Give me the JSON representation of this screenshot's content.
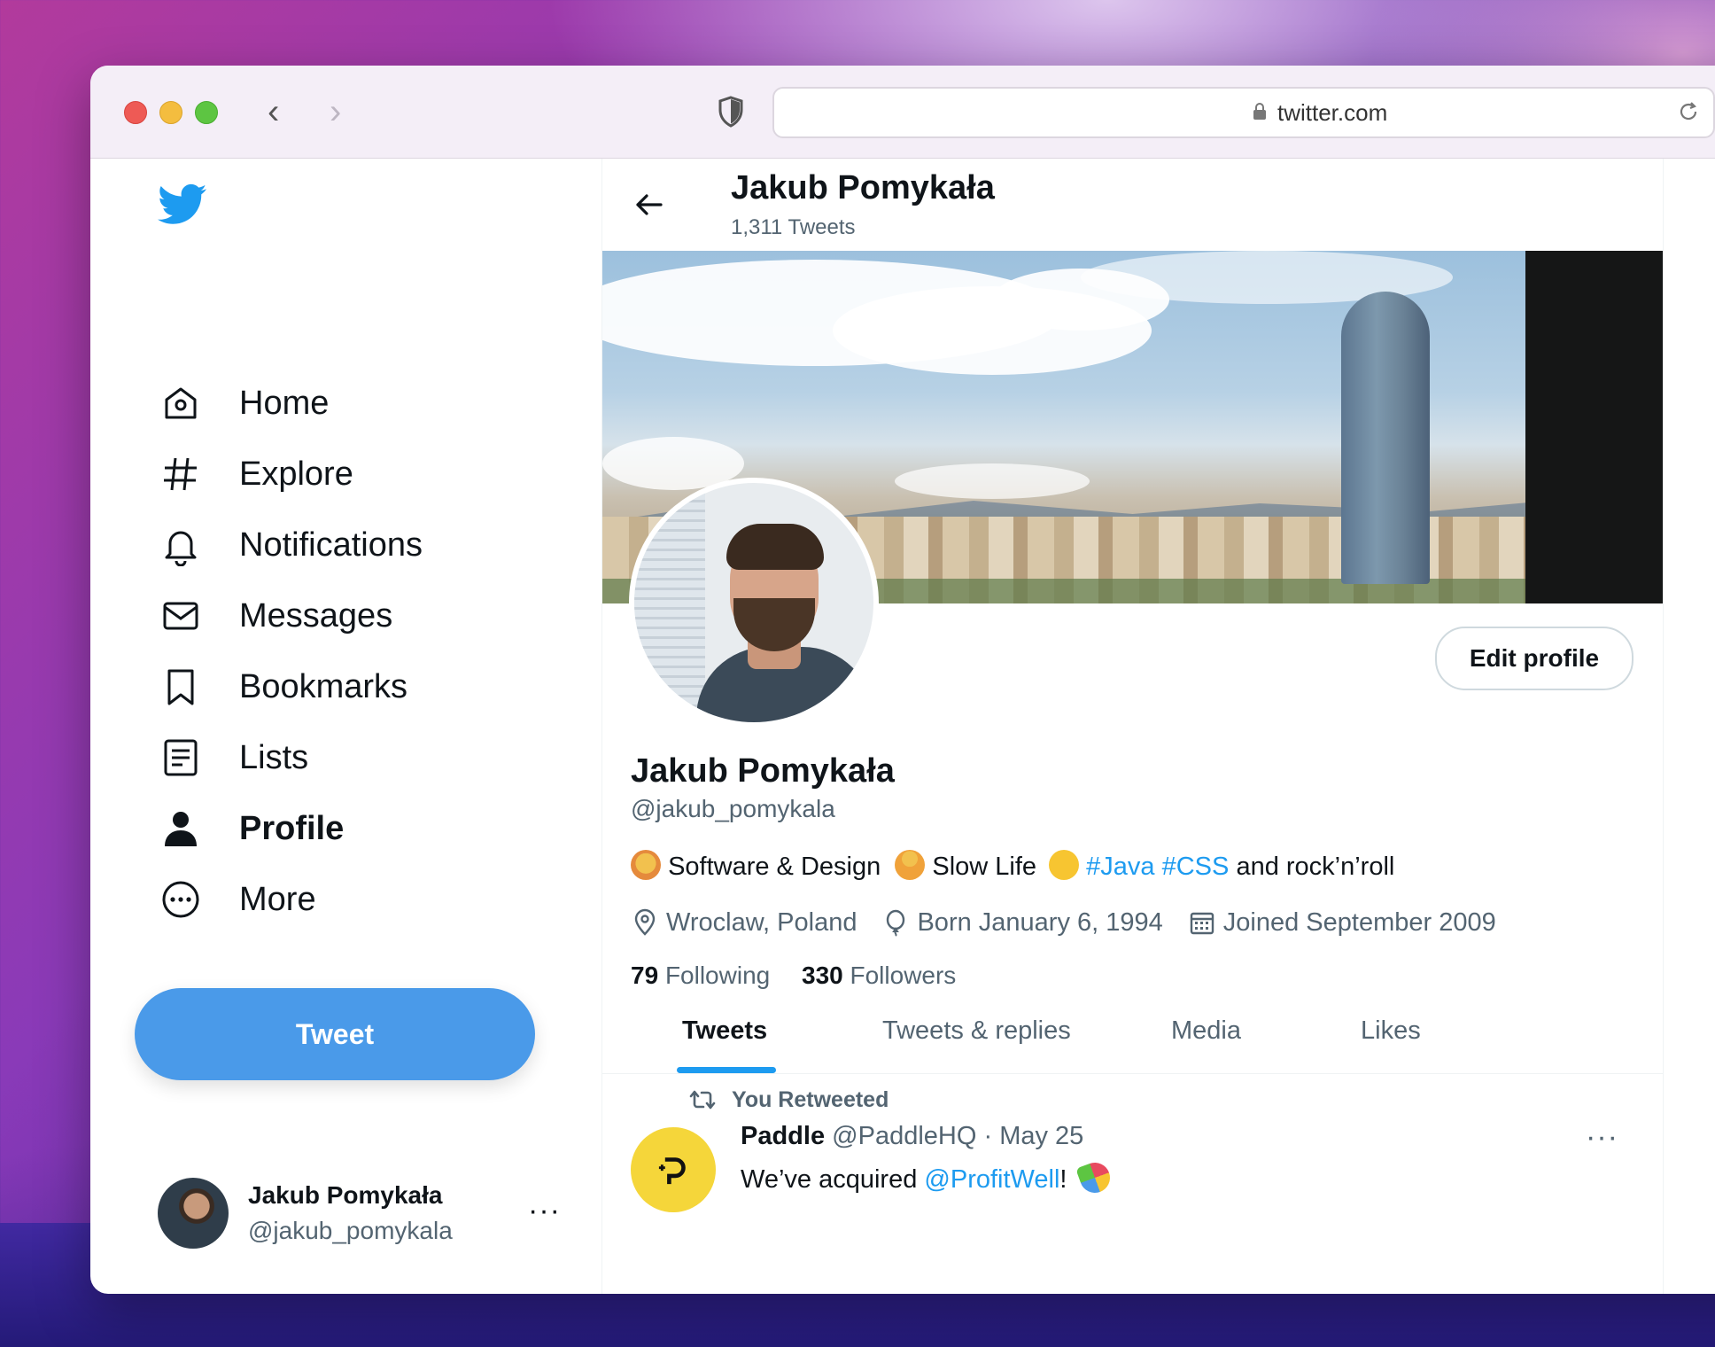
{
  "browser": {
    "url": "twitter.com"
  },
  "sidebar": {
    "items": [
      {
        "label": "Home",
        "icon": "home-icon"
      },
      {
        "label": "Explore",
        "icon": "hashtag-icon"
      },
      {
        "label": "Notifications",
        "icon": "bell-icon"
      },
      {
        "label": "Messages",
        "icon": "mail-icon"
      },
      {
        "label": "Bookmarks",
        "icon": "bookmark-icon"
      },
      {
        "label": "Lists",
        "icon": "list-icon"
      },
      {
        "label": "Profile",
        "icon": "person-icon"
      },
      {
        "label": "More",
        "icon": "more-circle-icon"
      }
    ],
    "tweet_button": "Tweet",
    "account": {
      "name": "Jakub Pomykała",
      "handle": "@jakub_pomykala",
      "more": "···"
    }
  },
  "header": {
    "name": "Jakub Pomykała",
    "tweet_count": "1,311 Tweets"
  },
  "profile": {
    "edit_button": "Edit profile",
    "name": "Jakub Pomykała",
    "handle": "@jakub_pomykala",
    "bio": {
      "part1": "Software & Design",
      "part2": "Slow Life",
      "tag1": "#Java",
      "tag2": "#CSS",
      "part3": "and rock’n’roll"
    },
    "location": "Wroclaw, Poland",
    "birthday": "Born January 6, 1994",
    "joined": "Joined September 2009",
    "following_count": "79",
    "following_label": "Following",
    "followers_count": "330",
    "followers_label": "Followers"
  },
  "tabs": [
    "Tweets",
    "Tweets & replies",
    "Media",
    "Likes"
  ],
  "tweet": {
    "retweet_label": "You Retweeted",
    "author_name": "Paddle",
    "author_handle": "@PaddleHQ",
    "separator": "·",
    "date": "May 25",
    "text_before": "We’ve acquired ",
    "mention": "@ProfitWell",
    "text_after": "!",
    "more": "···"
  },
  "colors": {
    "accent": "#1d9bf0",
    "tweet_button": "#4a9ae9",
    "paddle_avatar": "#f5d63a"
  }
}
